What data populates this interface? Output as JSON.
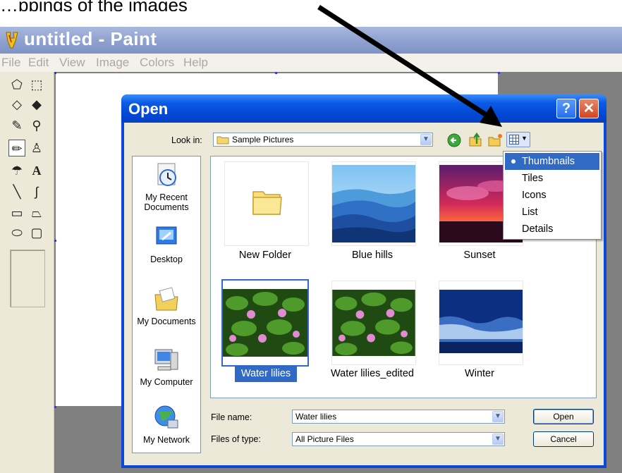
{
  "caption_fragment": "…ppings of the images",
  "paint": {
    "title": "untitled - Paint",
    "menu": [
      "File",
      "Edit",
      "View",
      "Image",
      "Colors",
      "Help"
    ]
  },
  "dialog": {
    "title": "Open",
    "help_label": "?",
    "close_label": "✕",
    "look_in_label": "Look in:",
    "look_in_value": "Sample Pictures",
    "places": [
      "My Recent Documents",
      "Desktop",
      "My Documents",
      "My Computer",
      "My Network"
    ],
    "files": [
      {
        "name": "New Folder",
        "kind": "folder"
      },
      {
        "name": "Blue hills",
        "kind": "image"
      },
      {
        "name": "Sunset",
        "kind": "image"
      },
      {
        "name": "Water lilies",
        "kind": "image",
        "selected": true
      },
      {
        "name": "Water lilies_edited",
        "kind": "image"
      },
      {
        "name": "Winter",
        "kind": "image"
      }
    ],
    "file_name_label": "File name:",
    "file_name_value": "Water lilies",
    "file_type_label": "Files of type:",
    "file_type_value": "All Picture Files",
    "open_button": "Open",
    "cancel_button": "Cancel",
    "view_menu": [
      {
        "label": "Thumbnails",
        "selected": true
      },
      {
        "label": "Tiles",
        "selected": false
      },
      {
        "label": "Icons",
        "selected": false
      },
      {
        "label": "List",
        "selected": false
      },
      {
        "label": "Details",
        "selected": false
      }
    ]
  },
  "colors": {
    "xp_title_blue": "#0a5ae6",
    "selection_blue": "#316ac5",
    "dialog_face": "#ece9d8"
  }
}
